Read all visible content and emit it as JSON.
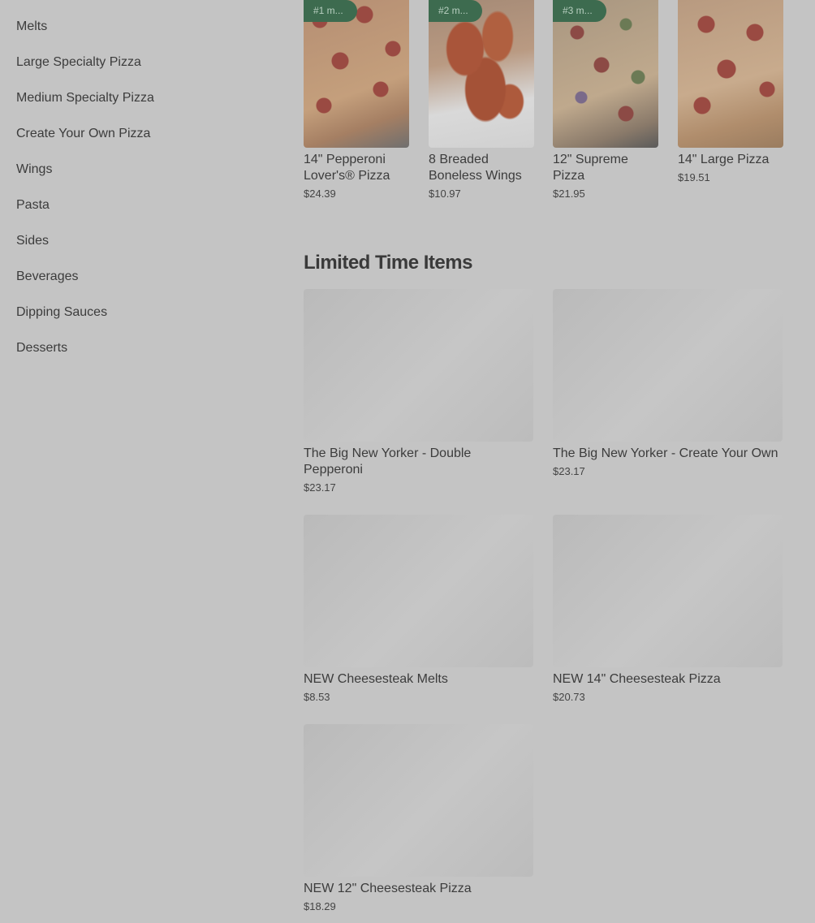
{
  "sidebar": {
    "items": [
      {
        "label": "Melts"
      },
      {
        "label": "Large Specialty Pizza"
      },
      {
        "label": "Medium Specialty Pizza"
      },
      {
        "label": "Create Your Own Pizza"
      },
      {
        "label": "Wings"
      },
      {
        "label": "Pasta"
      },
      {
        "label": "Sides"
      },
      {
        "label": "Beverages"
      },
      {
        "label": "Dipping Sauces"
      },
      {
        "label": "Desserts"
      }
    ]
  },
  "top_items": [
    {
      "badge": "#1 m...",
      "title": "14\" Pepperoni Lover's® Pizza",
      "price": "$24.39"
    },
    {
      "badge": "#2 m...",
      "title": "8 Breaded Boneless Wings",
      "price": "$10.97"
    },
    {
      "badge": "#3 m...",
      "title": "12\" Supreme Pizza",
      "price": "$21.95"
    },
    {
      "badge": "",
      "title": "14\" Large Pizza",
      "price": "$19.51"
    }
  ],
  "limited_time": {
    "title": "Limited Time Items",
    "items": [
      {
        "title": "The Big New Yorker - Double Pepperoni",
        "price": "$23.17"
      },
      {
        "title": "The Big New Yorker - Create Your Own",
        "price": "$23.17"
      },
      {
        "title": "NEW Cheesesteak Melts",
        "price": "$8.53"
      },
      {
        "title": "NEW 14\" Cheesesteak Pizza",
        "price": "$20.73"
      },
      {
        "title": "NEW 12\" Cheesesteak Pizza",
        "price": "$18.29"
      }
    ]
  },
  "colors": {
    "overlay_background": "#c4c4c4",
    "badge_green": "#3d6b4f",
    "text": "#3c3c3c"
  }
}
